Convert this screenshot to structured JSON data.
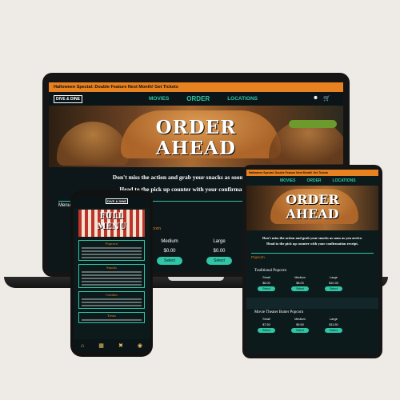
{
  "laptop": {
    "promo_banner": "Halloween Special: Double Feature Next Month! Get Tickets",
    "nav": {
      "logo": "DIVE & DINE",
      "links": [
        "MOVIES",
        "ORDER",
        "LOCATIONS"
      ]
    },
    "icons": [
      "user-icon",
      "cart-icon"
    ],
    "hero": {
      "line1": "ORDER",
      "line2": "AHEAD"
    },
    "intro_line1": "Don't miss the action and grab your snacks as soon as you arrive.",
    "intro_line2": "Head to the pick up counter with your confirmation receipt.",
    "menu_tab": "Menu",
    "section_title": "Popcorn",
    "sizes": [
      {
        "name": "Medium",
        "price": "$0.00",
        "button": "Select"
      },
      {
        "name": "Large",
        "price": "$0.00",
        "button": "Select"
      }
    ]
  },
  "phone": {
    "logo": "DIVE & DINE",
    "hero": {
      "line1": "FULL",
      "line2": "MENU"
    },
    "sections": [
      "Popcorn",
      "Snacks",
      "Combos",
      "Treats"
    ],
    "bottom_icons": [
      "home-icon",
      "tickets-icon",
      "food-icon",
      "location-icon"
    ]
  },
  "tablet": {
    "promo_banner": "Halloween Special: Double Feature Next Month! Get Tickets",
    "nav_links": [
      "MOVIES",
      "ORDER",
      "LOCATIONS"
    ],
    "hero": {
      "line1": "ORDER",
      "line2": "AHEAD"
    },
    "intro_line1": "Don't miss the action and grab your snacks as soon as you arrive.",
    "intro_line2": "Head to the pick up counter with your confirmation receipt.",
    "menu_tab": "Popcorn",
    "section1": {
      "title": "Traditional Popcorn",
      "sizes": [
        {
          "name": "Small",
          "price": "$6.00",
          "button": "Select"
        },
        {
          "name": "Medium",
          "price": "$8.00",
          "button": "Select"
        },
        {
          "name": "Large",
          "price": "$10.00",
          "button": "Select"
        }
      ]
    },
    "section2": {
      "title": "Movie Theater Butter Popcorn",
      "sizes": [
        {
          "name": "Small",
          "price": "$7.50",
          "button": "Select"
        },
        {
          "name": "Medium",
          "price": "$9.50",
          "button": "Select"
        },
        {
          "name": "Large",
          "price": "$11.50",
          "button": "Select"
        }
      ]
    }
  },
  "colors": {
    "accent_teal": "#2ec6a6",
    "accent_orange": "#e8811f",
    "background": "#eeebe6"
  }
}
